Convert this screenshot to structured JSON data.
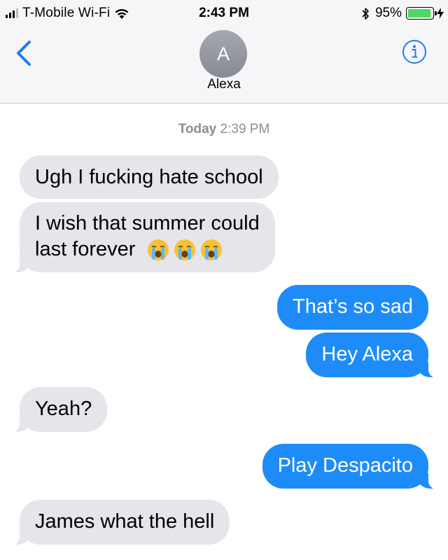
{
  "status_bar": {
    "carrier": "T-Mobile Wi-Fi",
    "time": "2:43 PM",
    "battery_percent": "95%",
    "battery_level": 0.95,
    "icons": [
      "signal-bars-icon",
      "wifi-icon",
      "bluetooth-icon",
      "battery-icon",
      "charging-bolt-icon"
    ]
  },
  "header": {
    "avatar_initial": "A",
    "contact_name": "Alexa",
    "back_icon": "chevron-left-icon",
    "info_icon": "info-circle-icon"
  },
  "thread": {
    "timestamp_day": "Today",
    "timestamp_time": "2:39 PM",
    "messages": [
      {
        "direction": "incoming",
        "text": "Ugh I fucking hate school"
      },
      {
        "direction": "incoming",
        "text": "I wish that summer could",
        "text_line2": "last forever",
        "emoji": [
          "crying-face-emoji",
          "crying-face-emoji",
          "crying-face-emoji"
        ]
      },
      {
        "direction": "outgoing",
        "text": "That’s so sad"
      },
      {
        "direction": "outgoing",
        "text": "Hey Alexa"
      },
      {
        "direction": "incoming",
        "text": "Yeah?"
      },
      {
        "direction": "outgoing",
        "text": "Play Despacito"
      },
      {
        "direction": "incoming",
        "text": "James what the hell"
      }
    ]
  },
  "colors": {
    "incoming_bubble": "#e5e5ea",
    "outgoing_bubble": "#1e8cf8",
    "accent": "#1e7cf2",
    "header_bg": "#f6f6f8"
  }
}
